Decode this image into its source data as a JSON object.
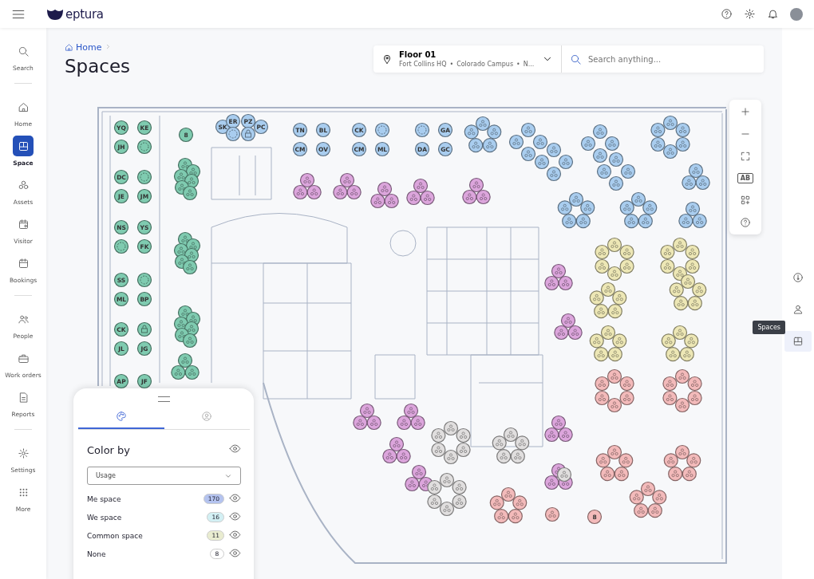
{
  "header": {
    "logo_text": "eptura"
  },
  "sidebar": {
    "sections": [
      {
        "items": [
          {
            "label": "Search",
            "selected": false
          }
        ]
      },
      {
        "items": [
          {
            "label": "Home",
            "selected": false
          },
          {
            "label": "Space",
            "selected": true
          },
          {
            "label": "Assets",
            "selected": false
          },
          {
            "label": "Visitor",
            "selected": false
          },
          {
            "label": "Bookings",
            "selected": false
          }
        ]
      },
      {
        "items": [
          {
            "label": "People",
            "selected": false
          },
          {
            "label": "Work orders",
            "selected": false
          },
          {
            "label": "Reports",
            "selected": false
          }
        ]
      },
      {
        "items": [
          {
            "label": "Settings",
            "selected": false
          },
          {
            "label": "More",
            "selected": false
          }
        ]
      }
    ]
  },
  "breadcrumb": {
    "items": [
      "Home"
    ]
  },
  "page_title": "Spaces",
  "floor_selector": {
    "title": "Floor 01",
    "path": [
      "Fort Collins HQ",
      "Colorado Campus",
      "N..."
    ],
    "separator": "•"
  },
  "search": {
    "placeholder": "Search anything..."
  },
  "map_toolbar": {
    "label_toggle": "AB"
  },
  "floor_plan": {
    "desk_groups": [
      {
        "color": "#7fcbb0",
        "seats": [
          {
            "kind": "initials",
            "label": "YQ"
          },
          {
            "kind": "initials",
            "label": "KE"
          },
          {
            "kind": "initials",
            "label": "JH"
          },
          {
            "kind": "free"
          }
        ]
      },
      {
        "color": "#7fcbb0",
        "seats": [
          {
            "kind": "initials",
            "label": "DC"
          },
          {
            "kind": "free"
          },
          {
            "kind": "initials",
            "label": "JE"
          },
          {
            "kind": "initials",
            "label": "JM"
          }
        ]
      },
      {
        "color": "#7fcbb0",
        "seats": [
          {
            "kind": "initials",
            "label": "NS"
          },
          {
            "kind": "initials",
            "label": "YS"
          },
          {
            "kind": "free"
          },
          {
            "kind": "initials",
            "label": "FK"
          }
        ]
      },
      {
        "color": "#7fcbb0",
        "seats": [
          {
            "kind": "initials",
            "label": "SS"
          },
          {
            "kind": "free"
          },
          {
            "kind": "initials",
            "label": "ML"
          },
          {
            "kind": "initials",
            "label": "BP"
          }
        ]
      },
      {
        "color": "#7fcbb0",
        "seats": [
          {
            "kind": "initials",
            "label": "CK"
          },
          {
            "kind": "locked"
          },
          {
            "kind": "initials",
            "label": "JL"
          },
          {
            "kind": "initials",
            "label": "JG"
          }
        ]
      },
      {
        "color": "#7fcbb0",
        "seats": [
          {
            "kind": "initials",
            "label": "AP"
          },
          {
            "kind": "initials",
            "label": "JF"
          }
        ]
      },
      {
        "color": "#7fcbb0",
        "seats": [
          {
            "kind": "initials",
            "label": "8"
          }
        ]
      },
      {
        "color": "#a9cdef",
        "seats": [
          {
            "kind": "initials",
            "label": "SK"
          },
          {
            "kind": "initials",
            "label": "ER"
          },
          {
            "kind": "initials",
            "label": "PZ"
          },
          {
            "kind": "initials",
            "label": "PC"
          },
          {
            "kind": "free"
          },
          {
            "kind": "locked"
          }
        ]
      },
      {
        "color": "#a9cdef",
        "seats": [
          {
            "kind": "initials",
            "label": "TN"
          },
          {
            "kind": "initials",
            "label": "BL"
          },
          {
            "kind": "initials",
            "label": "CM"
          },
          {
            "kind": "initials",
            "label": "OV"
          }
        ]
      },
      {
        "color": "#a9cdef",
        "seats": [
          {
            "kind": "initials",
            "label": "CK"
          },
          {
            "kind": "free"
          },
          {
            "kind": "initials",
            "label": "CM"
          },
          {
            "kind": "initials",
            "label": "ML"
          }
        ]
      },
      {
        "color": "#a9cdef",
        "seats": [
          {
            "kind": "free"
          },
          {
            "kind": "initials",
            "label": "GA"
          },
          {
            "kind": "initials",
            "label": "DA"
          },
          {
            "kind": "initials",
            "label": "GC"
          }
        ]
      },
      {
        "color": "#7fcbb0",
        "seats": [
          {
            "kind": "person"
          },
          {
            "kind": "person"
          },
          {
            "kind": "person"
          },
          {
            "kind": "person"
          },
          {
            "kind": "person"
          },
          {
            "kind": "person"
          }
        ]
      },
      {
        "color": "#7fcbb0",
        "seats": [
          {
            "kind": "person"
          },
          {
            "kind": "person"
          },
          {
            "kind": "person"
          },
          {
            "kind": "person"
          },
          {
            "kind": "person"
          },
          {
            "kind": "person"
          }
        ]
      },
      {
        "color": "#7fcbb0",
        "seats": [
          {
            "kind": "person"
          },
          {
            "kind": "person"
          },
          {
            "kind": "person"
          },
          {
            "kind": "person"
          },
          {
            "kind": "person"
          },
          {
            "kind": "person"
          }
        ]
      },
      {
        "color": "#7fcbb0",
        "seats": [
          {
            "kind": "person"
          },
          {
            "kind": "person"
          },
          {
            "kind": "person"
          }
        ]
      },
      {
        "color": "#a9cdef",
        "seats": [
          {
            "kind": "person"
          },
          {
            "kind": "person"
          },
          {
            "kind": "person"
          },
          {
            "kind": "person"
          },
          {
            "kind": "person"
          }
        ]
      },
      {
        "color": "#a9cdef",
        "seats": [
          {
            "kind": "person"
          },
          {
            "kind": "person"
          },
          {
            "kind": "person"
          },
          {
            "kind": "person"
          }
        ]
      },
      {
        "color": "#a9cdef",
        "seats": [
          {
            "kind": "person"
          },
          {
            "kind": "person"
          },
          {
            "kind": "person"
          },
          {
            "kind": "person"
          }
        ]
      },
      {
        "color": "#a9cdef",
        "seats": [
          {
            "kind": "person"
          },
          {
            "kind": "person"
          },
          {
            "kind": "person"
          },
          {
            "kind": "person"
          }
        ]
      },
      {
        "color": "#a9cdef",
        "seats": [
          {
            "kind": "person"
          },
          {
            "kind": "person"
          },
          {
            "kind": "person"
          },
          {
            "kind": "person"
          }
        ]
      },
      {
        "color": "#a9cdef",
        "seats": [
          {
            "kind": "person"
          },
          {
            "kind": "person"
          },
          {
            "kind": "person"
          },
          {
            "kind": "person"
          },
          {
            "kind": "person"
          },
          {
            "kind": "person"
          }
        ]
      },
      {
        "color": "#a9cdef",
        "seats": [
          {
            "kind": "person"
          },
          {
            "kind": "person"
          },
          {
            "kind": "person"
          }
        ]
      },
      {
        "color": "#a9cdef",
        "seats": [
          {
            "kind": "person"
          },
          {
            "kind": "person"
          },
          {
            "kind": "person"
          },
          {
            "kind": "person"
          },
          {
            "kind": "person"
          }
        ]
      },
      {
        "color": "#a9cdef",
        "seats": [
          {
            "kind": "person"
          },
          {
            "kind": "person"
          },
          {
            "kind": "person"
          },
          {
            "kind": "person"
          },
          {
            "kind": "person"
          }
        ]
      },
      {
        "color": "#a9cdef",
        "seats": [
          {
            "kind": "person"
          },
          {
            "kind": "person"
          },
          {
            "kind": "person"
          }
        ]
      },
      {
        "color": "#dca5dc",
        "seats": [
          {
            "kind": "person"
          },
          {
            "kind": "person"
          },
          {
            "kind": "person"
          }
        ]
      },
      {
        "color": "#dca5dc",
        "seats": [
          {
            "kind": "person"
          },
          {
            "kind": "person"
          },
          {
            "kind": "person"
          }
        ]
      },
      {
        "color": "#dca5dc",
        "seats": [
          {
            "kind": "person"
          },
          {
            "kind": "person"
          },
          {
            "kind": "person"
          }
        ]
      },
      {
        "color": "#dca5dc",
        "seats": [
          {
            "kind": "person"
          },
          {
            "kind": "person"
          },
          {
            "kind": "person"
          }
        ]
      },
      {
        "color": "#dca5dc",
        "seats": [
          {
            "kind": "person"
          },
          {
            "kind": "person"
          },
          {
            "kind": "person"
          }
        ]
      },
      {
        "color": "#dca5dc",
        "seats": [
          {
            "kind": "person"
          },
          {
            "kind": "person"
          },
          {
            "kind": "person"
          }
        ]
      },
      {
        "color": "#dca5dc",
        "seats": [
          {
            "kind": "person"
          },
          {
            "kind": "person"
          },
          {
            "kind": "person"
          }
        ]
      },
      {
        "color": "#dca5dc",
        "seats": [
          {
            "kind": "person"
          },
          {
            "kind": "person"
          },
          {
            "kind": "person"
          }
        ]
      },
      {
        "color": "#dca5dc",
        "seats": [
          {
            "kind": "person"
          },
          {
            "kind": "person"
          },
          {
            "kind": "person"
          }
        ]
      },
      {
        "color": "#dca5dc",
        "seats": [
          {
            "kind": "person"
          },
          {
            "kind": "person"
          },
          {
            "kind": "person"
          }
        ]
      },
      {
        "color": "#dca5dc",
        "seats": [
          {
            "kind": "person"
          },
          {
            "kind": "person"
          },
          {
            "kind": "person"
          }
        ]
      },
      {
        "color": "#dca5dc",
        "seats": [
          {
            "kind": "person"
          },
          {
            "kind": "person"
          },
          {
            "kind": "person"
          }
        ]
      },
      {
        "color": "#dca5dc",
        "seats": [
          {
            "kind": "person"
          },
          {
            "kind": "person"
          },
          {
            "kind": "person"
          }
        ]
      },
      {
        "color": "#ede7b5",
        "seats": [
          {
            "kind": "person"
          },
          {
            "kind": "person"
          },
          {
            "kind": "person"
          },
          {
            "kind": "person"
          },
          {
            "kind": "person"
          },
          {
            "kind": "person"
          }
        ]
      },
      {
        "color": "#ede7b5",
        "seats": [
          {
            "kind": "person"
          },
          {
            "kind": "person"
          },
          {
            "kind": "person"
          },
          {
            "kind": "person"
          },
          {
            "kind": "person"
          },
          {
            "kind": "person"
          }
        ]
      },
      {
        "color": "#ede7b5",
        "seats": [
          {
            "kind": "person"
          },
          {
            "kind": "person"
          },
          {
            "kind": "person"
          },
          {
            "kind": "person"
          },
          {
            "kind": "person"
          }
        ]
      },
      {
        "color": "#ede7b5",
        "seats": [
          {
            "kind": "person"
          },
          {
            "kind": "person"
          },
          {
            "kind": "person"
          },
          {
            "kind": "person"
          },
          {
            "kind": "person"
          }
        ]
      },
      {
        "color": "#ede7b5",
        "seats": [
          {
            "kind": "person"
          },
          {
            "kind": "person"
          },
          {
            "kind": "person"
          },
          {
            "kind": "person"
          },
          {
            "kind": "person"
          }
        ]
      },
      {
        "color": "#ede7b5",
        "seats": [
          {
            "kind": "person"
          },
          {
            "kind": "person"
          },
          {
            "kind": "person"
          },
          {
            "kind": "person"
          },
          {
            "kind": "person"
          }
        ]
      },
      {
        "color": "#f3baba",
        "seats": [
          {
            "kind": "person"
          },
          {
            "kind": "person"
          },
          {
            "kind": "person"
          },
          {
            "kind": "person"
          },
          {
            "kind": "person"
          },
          {
            "kind": "person"
          }
        ]
      },
      {
        "color": "#f3baba",
        "seats": [
          {
            "kind": "person"
          },
          {
            "kind": "person"
          },
          {
            "kind": "person"
          },
          {
            "kind": "person"
          },
          {
            "kind": "person"
          },
          {
            "kind": "person"
          }
        ]
      },
      {
        "color": "#f3baba",
        "seats": [
          {
            "kind": "person"
          },
          {
            "kind": "person"
          },
          {
            "kind": "person"
          },
          {
            "kind": "person"
          },
          {
            "kind": "person"
          }
        ]
      },
      {
        "color": "#f3baba",
        "seats": [
          {
            "kind": "person"
          },
          {
            "kind": "person"
          },
          {
            "kind": "person"
          },
          {
            "kind": "person"
          },
          {
            "kind": "person"
          }
        ]
      },
      {
        "color": "#f3baba",
        "seats": [
          {
            "kind": "person"
          },
          {
            "kind": "person"
          },
          {
            "kind": "person"
          },
          {
            "kind": "person"
          },
          {
            "kind": "person"
          }
        ]
      },
      {
        "color": "#f3baba",
        "seats": [
          {
            "kind": "person"
          },
          {
            "kind": "person"
          },
          {
            "kind": "person"
          },
          {
            "kind": "person"
          },
          {
            "kind": "person"
          }
        ]
      },
      {
        "color": "#e0dede",
        "seats": [
          {
            "kind": "person"
          },
          {
            "kind": "person"
          },
          {
            "kind": "person"
          },
          {
            "kind": "person"
          },
          {
            "kind": "person"
          },
          {
            "kind": "person"
          }
        ]
      },
      {
        "color": "#e0dede",
        "seats": [
          {
            "kind": "person"
          },
          {
            "kind": "person"
          },
          {
            "kind": "person"
          },
          {
            "kind": "person"
          },
          {
            "kind": "person"
          }
        ]
      },
      {
        "color": "#e0dede",
        "seats": [
          {
            "kind": "person"
          },
          {
            "kind": "person"
          },
          {
            "kind": "person"
          },
          {
            "kind": "person"
          },
          {
            "kind": "person"
          },
          {
            "kind": "person"
          }
        ]
      },
      {
        "color": "#e0dede",
        "seats": [
          {
            "kind": "person"
          }
        ]
      },
      {
        "color": "#f3baba",
        "seats": [
          {
            "kind": "person"
          }
        ]
      },
      {
        "color": "#f3baba",
        "seats": [
          {
            "kind": "initials",
            "label": "8"
          }
        ]
      }
    ]
  },
  "panel": {
    "tabs": [
      {
        "kind": "palette",
        "selected": true
      },
      {
        "kind": "person",
        "selected": false
      }
    ],
    "title": "Color by",
    "dropdown": {
      "value": "Usage"
    },
    "legend": [
      {
        "label": "Me space",
        "count": "170",
        "color": "#b4c3ef"
      },
      {
        "label": "We space",
        "count": "16",
        "color": "#d3f0f4"
      },
      {
        "label": "Common space",
        "count": "11",
        "color": "#e9ecd0"
      },
      {
        "label": "None",
        "count": "8",
        "color": "#ffffff"
      }
    ]
  },
  "right_rail": {
    "items": [
      {
        "kind": "thermometer",
        "selected": false
      },
      {
        "kind": "person",
        "selected": false
      },
      {
        "kind": "spaces",
        "selected": true
      }
    ],
    "tooltip": "Spaces"
  }
}
